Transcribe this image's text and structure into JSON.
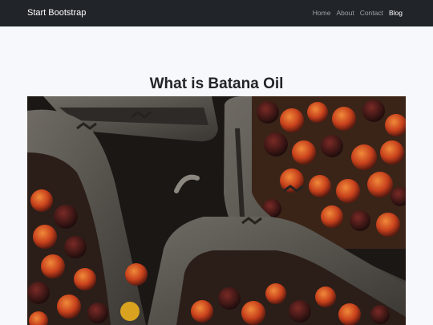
{
  "navbar": {
    "brand": "Start Bootstrap",
    "links": [
      "Home",
      "About",
      "Contact",
      "Blog"
    ],
    "active": "Blog"
  },
  "main": {
    "title": "What is Batana Oil"
  },
  "colors": {
    "navbar_bg": "#212529",
    "page_bg": "#f7f8fb",
    "nav_link": "#9ca3ab",
    "nav_active": "#ffffff"
  }
}
